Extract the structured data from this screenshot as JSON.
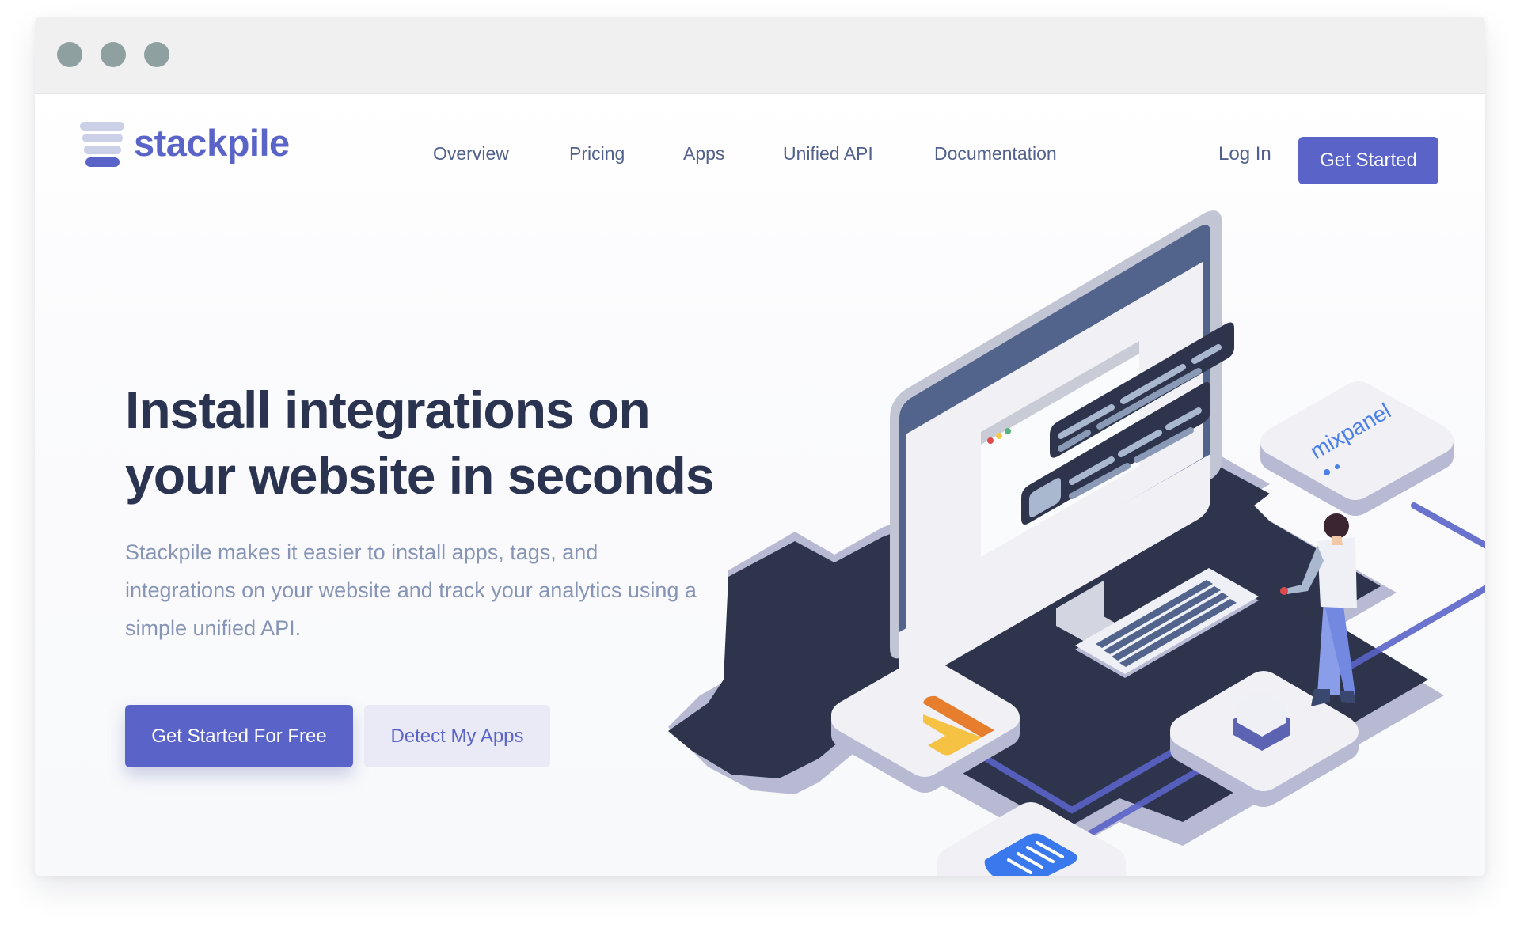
{
  "window": {
    "controls": [
      "close",
      "minimize",
      "maximize"
    ]
  },
  "brand": {
    "name": "stackpile",
    "logo_icon": "stack-layers-icon",
    "color": "#5a64c8"
  },
  "nav": {
    "items": [
      {
        "label": "Overview"
      },
      {
        "label": "Pricing"
      },
      {
        "label": "Apps"
      },
      {
        "label": "Unified API"
      },
      {
        "label": "Documentation"
      }
    ],
    "login_label": "Log In",
    "cta_label": "Get Started"
  },
  "hero": {
    "title_line1": "Install integrations on",
    "title_line2": "your website in seconds",
    "subtitle": "Stackpile makes it easier to install apps, tags, and integrations on your website and track your analytics using a simple unified API.",
    "primary_button": "Get Started For Free",
    "secondary_button": "Detect My Apps"
  },
  "illustration": {
    "description": "isometric computer with code windows, keyboard, person, and integration tiles",
    "tiles": [
      {
        "name": "mixpanel",
        "label": "mixpanel"
      },
      {
        "name": "google-analytics",
        "label": ""
      },
      {
        "name": "intercom",
        "label": ""
      }
    ]
  },
  "colors": {
    "accent": "#5a64c8",
    "heading": "#2a3350",
    "body_text": "#8694b6",
    "nav_text": "#52618c",
    "dark_base": "#2d344c"
  }
}
